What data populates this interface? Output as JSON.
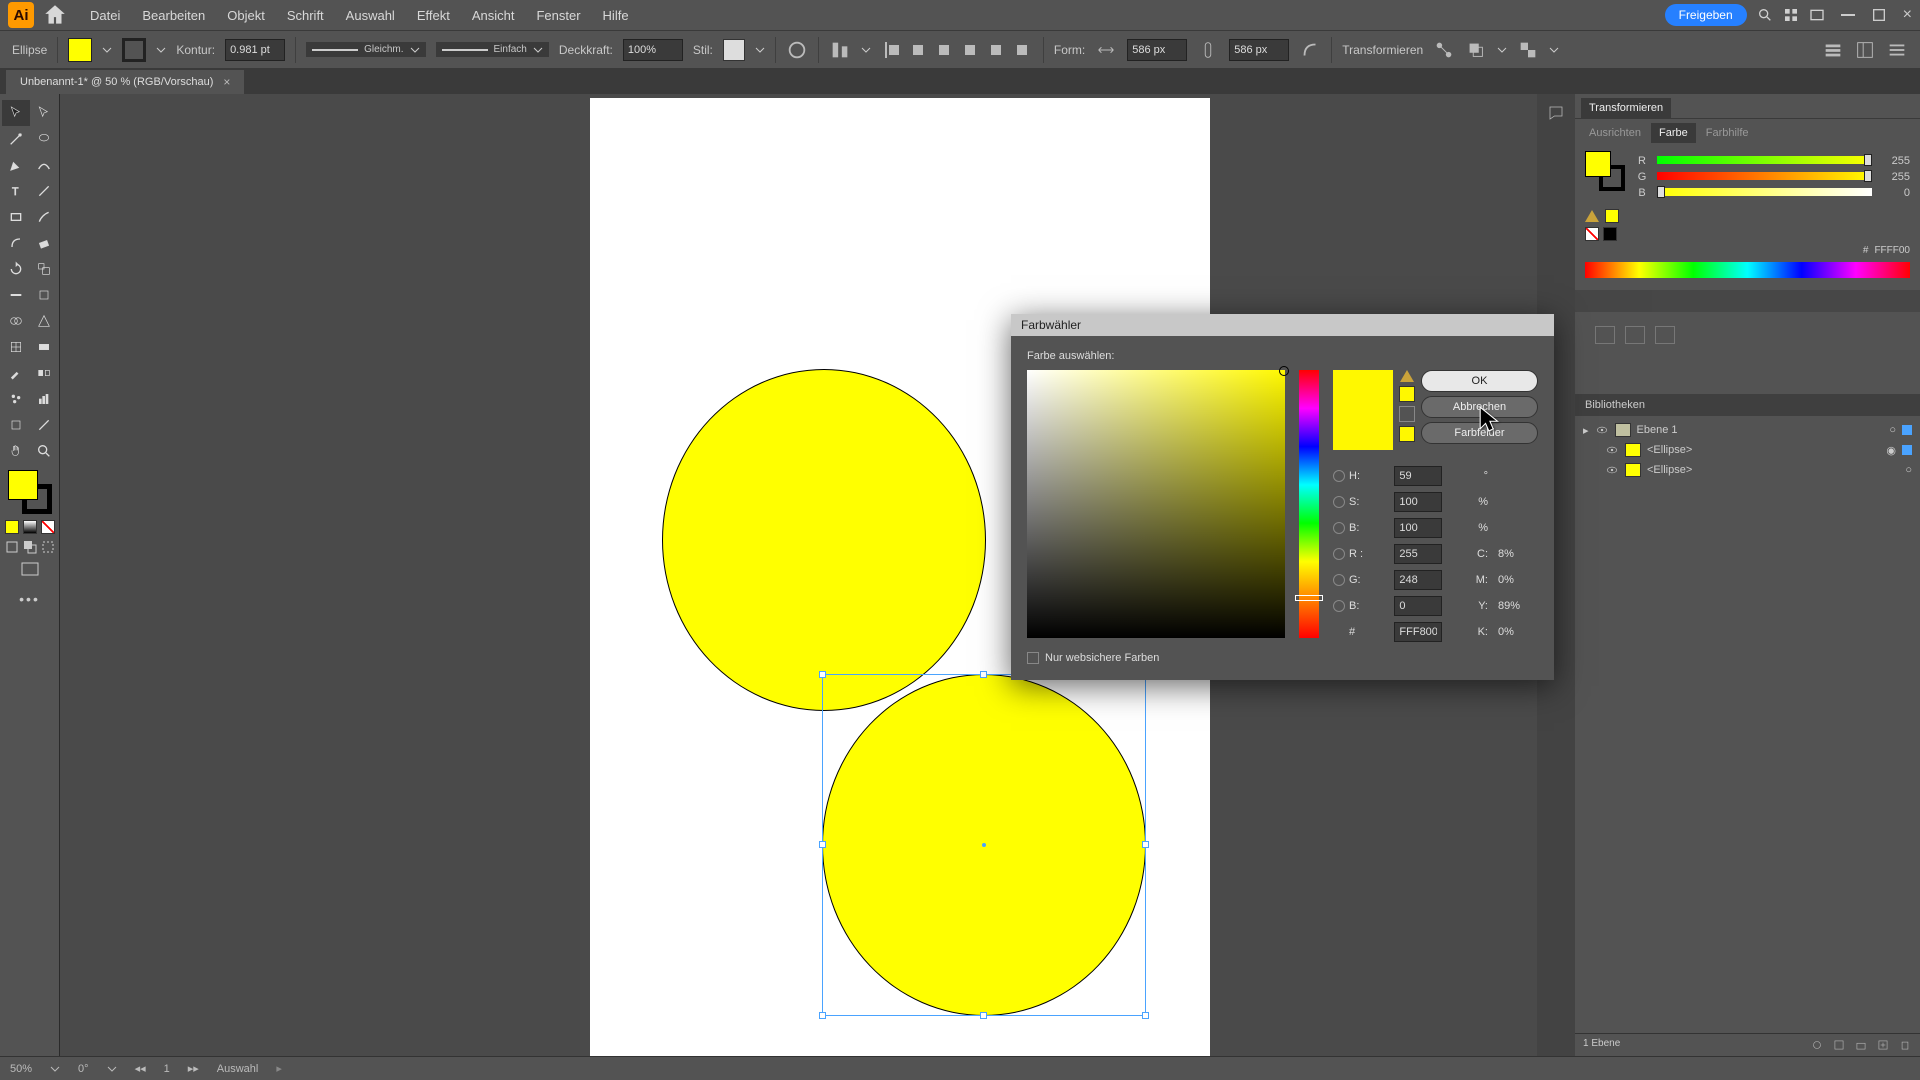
{
  "app": {
    "logo_text": "Ai"
  },
  "menu": [
    "Datei",
    "Bearbeiten",
    "Objekt",
    "Schrift",
    "Auswahl",
    "Effekt",
    "Ansicht",
    "Fenster",
    "Hilfe"
  ],
  "share_label": "Freigeben",
  "control": {
    "shape_label": "Ellipse",
    "kontur_label": "Kontur:",
    "kontur_val": "0.981 pt",
    "stroke_style1": "Gleichm.",
    "stroke_style2": "Einfach",
    "deck_label": "Deckkraft:",
    "deck_val": "100%",
    "stil_label": "Stil:",
    "form_label": "Form:",
    "w_val": "586 px",
    "h_val": "586 px",
    "trans_label": "Transformieren"
  },
  "tab": {
    "title": "Unbenannt-1* @ 50 % (RGB/Vorschau)"
  },
  "right": {
    "panel1_tab": "Transformieren",
    "tabs2": [
      "Ausrichten",
      "Farbe",
      "Farbhilfe"
    ],
    "color": {
      "r": "255",
      "g": "255",
      "b": "0",
      "hex_prefix": "#",
      "hex": "FFFF00"
    },
    "bibliotheken": "Bibliotheken",
    "layer_name": "Ebene 1",
    "item1": "<Ellipse>",
    "item2": "<Ellipse>"
  },
  "dialog": {
    "title": "Farbwähler",
    "select_label": "Farbe auswählen:",
    "ok": "OK",
    "cancel": "Abbrechen",
    "swatches": "Farbfelder",
    "H_label": "H:",
    "H_val": "59",
    "H_suffix": "°",
    "S_label": "S:",
    "S_val": "100",
    "S_suffix": "%",
    "Bv_label": "B:",
    "Bv_val": "100",
    "Bv_suffix": "%",
    "R_label": "R :",
    "R_val": "255",
    "G_label": "G:",
    "G_val": "248",
    "Bl_label": "B:",
    "Bl_val": "0",
    "hash": "#",
    "hex": "FFF800",
    "C_label": "C:",
    "C_val": "8%",
    "M_label": "M:",
    "M_val": "0%",
    "Y_label": "Y:",
    "Y_val": "89%",
    "K_label": "K:",
    "K_val": "0%",
    "websafe": "Nur websichere Farben"
  },
  "status": {
    "zoom": "50%",
    "angle": "0°",
    "page": "1",
    "mode": "Auswahl",
    "layers_count": "1 Ebene"
  }
}
